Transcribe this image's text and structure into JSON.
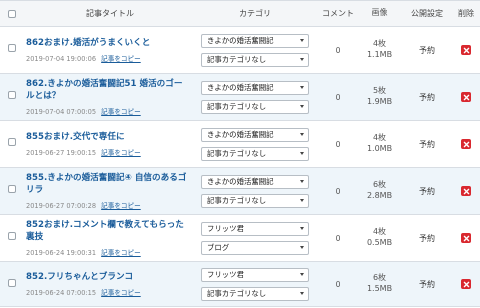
{
  "header": {
    "title": "記事タイトル",
    "category": "カテゴリ",
    "comments": "コメント",
    "images": "画像",
    "publish": "公開設定",
    "delete": "削除"
  },
  "rows": [
    {
      "title": "862おまけ.婚活がうまくいくと",
      "date": "2019-07-04 19:00:06",
      "copy": "記事をコピー",
      "category1": "きよかの婚活奮闘記",
      "category2": "記事カテゴリなし",
      "comments": "0",
      "images_count": "4枚",
      "images_size": "1.1MB",
      "status": "予約"
    },
    {
      "title": "862.きよかの婚活奮闘記51 婚活のゴールとは？",
      "date": "2019-07-04 07:00:05",
      "copy": "記事をコピー",
      "category1": "きよかの婚活奮闘記",
      "category2": "記事カテゴリなし",
      "comments": "0",
      "images_count": "5枚",
      "images_size": "1.9MB",
      "status": "予約"
    },
    {
      "title": "855おまけ.交代で専任に",
      "date": "2019-06-27 19:00:15",
      "copy": "記事をコピー",
      "category1": "きよかの婚活奮闘記",
      "category2": "記事カテゴリなし",
      "comments": "0",
      "images_count": "4枚",
      "images_size": "1.0MB",
      "status": "予約"
    },
    {
      "title": "855.きよかの婚活奮闘記④ 自信のあるゴリラ",
      "date": "2019-06-27 07:00:28",
      "copy": "記事をコピー",
      "category1": "きよかの婚活奮闘記",
      "category2": "記事カテゴリなし",
      "comments": "0",
      "images_count": "6枚",
      "images_size": "2.8MB",
      "status": "予約"
    },
    {
      "title": "852おまけ.コメント欄で教えてもらった裏技",
      "date": "2019-06-24 19:00:31",
      "copy": "記事をコピー",
      "category1": "フリッツ君",
      "category2": "ブログ",
      "comments": "0",
      "images_count": "4枚",
      "images_size": "0.5MB",
      "status": "予約"
    },
    {
      "title": "852.フリちゃんとブランコ",
      "date": "2019-06-24 07:00:15",
      "copy": "記事をコピー",
      "category1": "フリッツ君",
      "category2": "記事カテゴリなし",
      "comments": "0",
      "images_count": "6枚",
      "images_size": "1.5MB",
      "status": "予約"
    }
  ]
}
